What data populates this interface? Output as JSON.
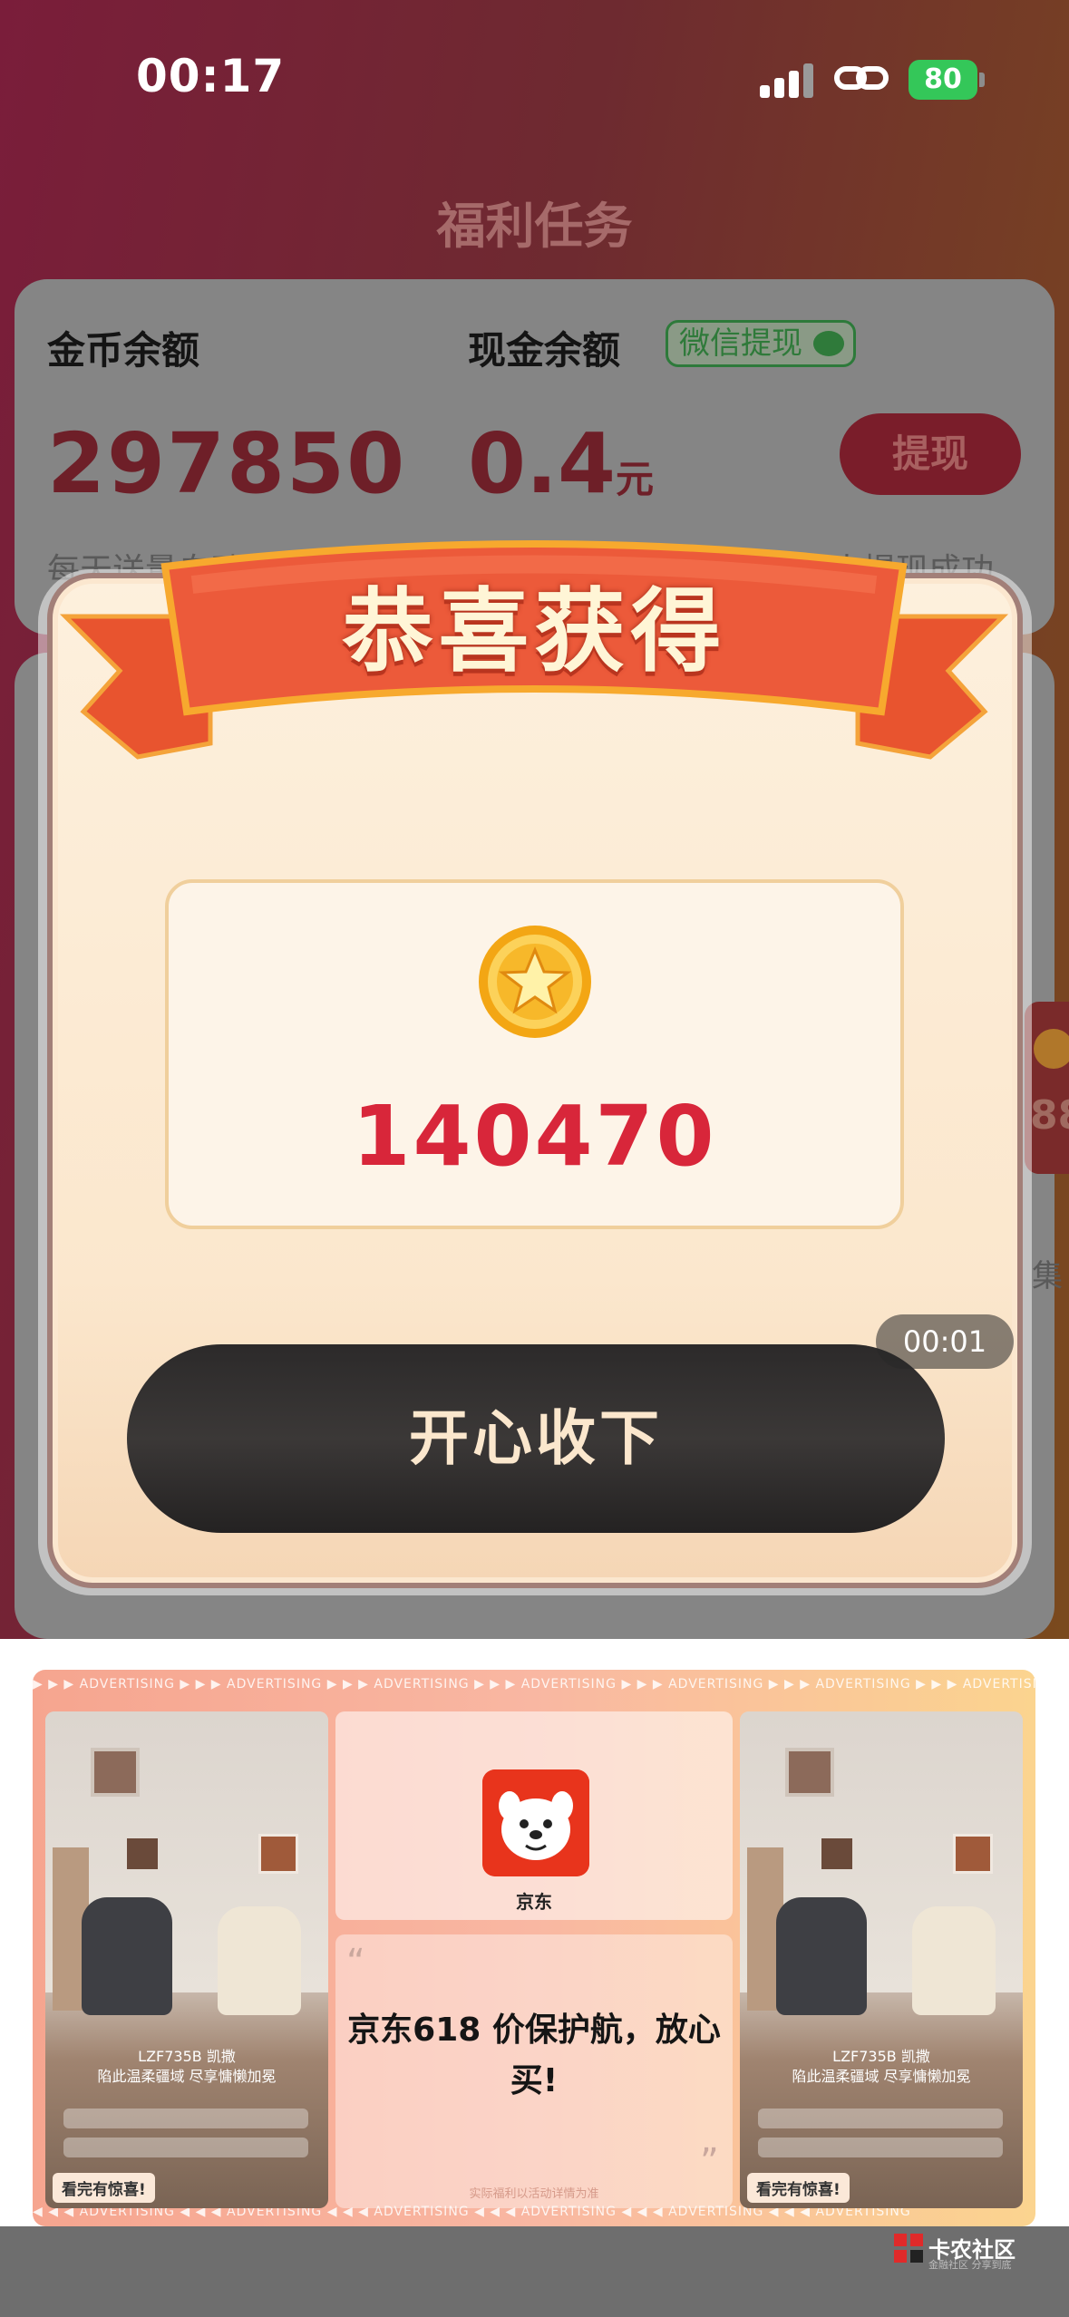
{
  "status_bar": {
    "time": "00:17",
    "battery": "80"
  },
  "page": {
    "title": "福利任务"
  },
  "balance_card": {
    "gold_label": "金币余额",
    "cash_label": "现金余额",
    "wechat_badge": "微信提现",
    "gold_value": "297850",
    "cash_value": "0.4",
    "cash_unit": "元",
    "withdraw_button": "提现",
    "sub_left": "每天送量自动",
    "sub_right": "人提现成功"
  },
  "side": {
    "peek_value": "88",
    "peek_text": "集"
  },
  "popup": {
    "title": "恭喜获得",
    "amount": "140470",
    "accept_button": "开心收下"
  },
  "ad": {
    "strip_text": "▶ ▶ ▶    ADVERTISING    ▶ ▶ ▶    ADVERTISING    ▶ ▶ ▶    ADVERTISING    ▶ ▶ ▶    ADVERTISING    ▶ ▶ ▶    ADVERTISING    ▶ ▶ ▶    ADVERTISING    ▶ ▶ ▶    ADVERTISING",
    "strip_text_bottom": "◀ ◀ ◀    ADVERTISING    ◀ ◀ ◀    ADVERTISING    ◀ ◀ ◀    ADVERTISING    ◀ ◀ ◀    ADVERTISING    ◀ ◀ ◀    ADVERTISING    ◀ ◀ ◀    ADVERTISING",
    "brand": "京东",
    "headline": "京东618 价保护航，放心买!",
    "fine_print": "实际福利以活动详情为准",
    "photo_caption_1": "LZF735B 凯撒",
    "photo_caption_2": "陷此温柔疆域 尽享慵懒加冕",
    "photo_tag": "看完有惊喜!",
    "timer": "00:01"
  },
  "watermark": {
    "name": "卡农社区",
    "sub": "金融社区 分享到底"
  }
}
